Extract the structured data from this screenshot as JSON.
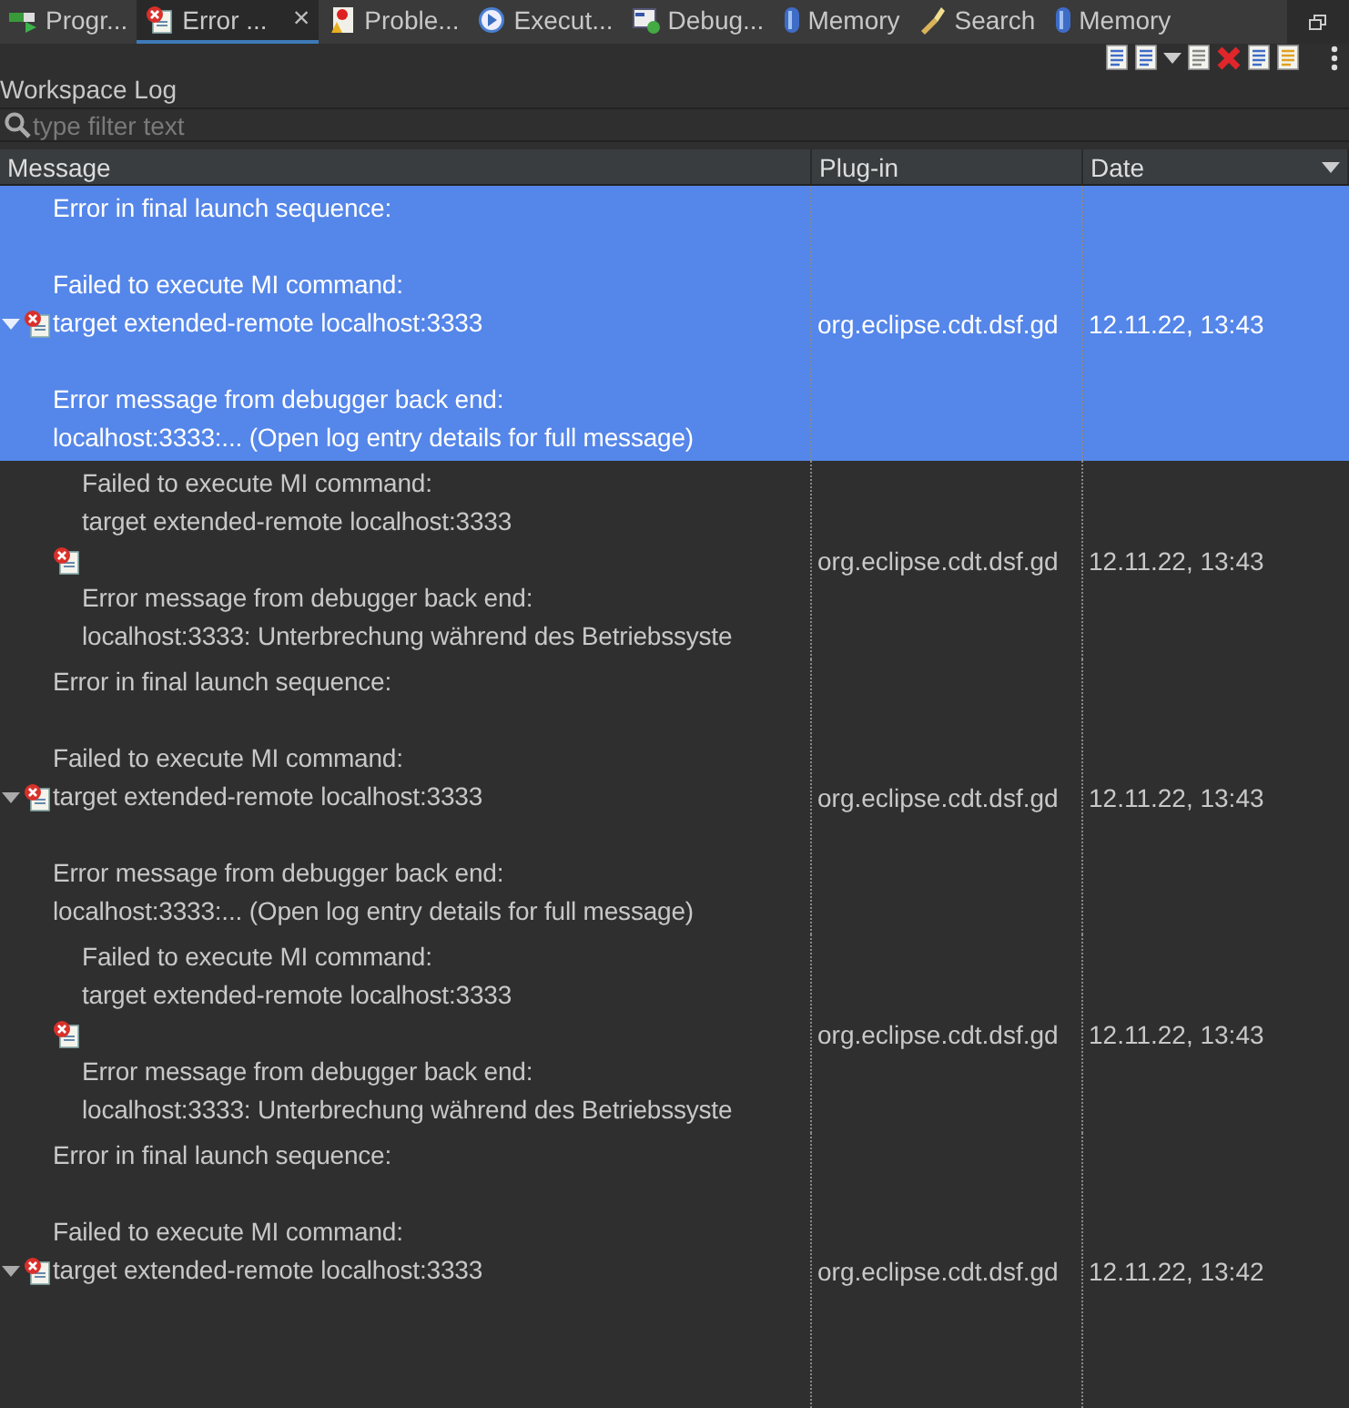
{
  "tabs": [
    {
      "label": "Progr...",
      "kind": "progress",
      "selected": false
    },
    {
      "label": "Error ...",
      "kind": "errorlog",
      "selected": true,
      "close": "×"
    },
    {
      "label": "Proble...",
      "kind": "problems",
      "selected": false
    },
    {
      "label": "Execut...",
      "kind": "execution",
      "selected": false
    },
    {
      "label": "Debug...",
      "kind": "debug",
      "selected": false
    },
    {
      "label": "Memory",
      "kind": "memory",
      "selected": false
    },
    {
      "label": "Search",
      "kind": "search",
      "selected": false
    },
    {
      "label": "Memory",
      "kind": "memory",
      "selected": false
    }
  ],
  "log_title": "Workspace Log",
  "filter": {
    "placeholder": "type filter text"
  },
  "table": {
    "columns": [
      {
        "label": "Message",
        "sort": false
      },
      {
        "label": "Plug-in",
        "sort": false
      },
      {
        "label": "Date",
        "sort": true
      }
    ],
    "rows": [
      {
        "kind": "group",
        "selected": true,
        "expanded": true,
        "message": "Error in final launch sequence:\n\nFailed to execute MI command:\ntarget extended-remote localhost:3333\n\nError message from debugger back end:\nlocalhost:3333:... (Open log entry details for full message)",
        "plugin": "org.eclipse.cdt.dsf.gd",
        "date": "12.11.22, 13:43",
        "children": [
          {
            "kind": "entry",
            "selected": false,
            "message": "Failed to execute MI command:\ntarget extended-remote localhost:3333\n\nError message from debugger back end:\nlocalhost:3333: Unterbrechung während des Betriebssyste",
            "plugin": "org.eclipse.cdt.dsf.gd",
            "date": "12.11.22, 13:43"
          }
        ]
      },
      {
        "kind": "group",
        "selected": false,
        "expanded": true,
        "message": "Error in final launch sequence:\n\nFailed to execute MI command:\ntarget extended-remote localhost:3333\n\nError message from debugger back end:\nlocalhost:3333:... (Open log entry details for full message)",
        "plugin": "org.eclipse.cdt.dsf.gd",
        "date": "12.11.22, 13:43",
        "children": [
          {
            "kind": "entry",
            "selected": false,
            "message": "Failed to execute MI command:\ntarget extended-remote localhost:3333\n\nError message from debugger back end:\nlocalhost:3333: Unterbrechung während des Betriebssyste",
            "plugin": "org.eclipse.cdt.dsf.gd",
            "date": "12.11.22, 13:43"
          }
        ]
      },
      {
        "kind": "group",
        "selected": false,
        "expanded": true,
        "message": "Error in final launch sequence:\n\nFailed to execute MI command:\ntarget extended-remote localhost:3333",
        "plugin": "org.eclipse.cdt.dsf.gd",
        "date": "12.11.22, 13:42"
      }
    ]
  }
}
